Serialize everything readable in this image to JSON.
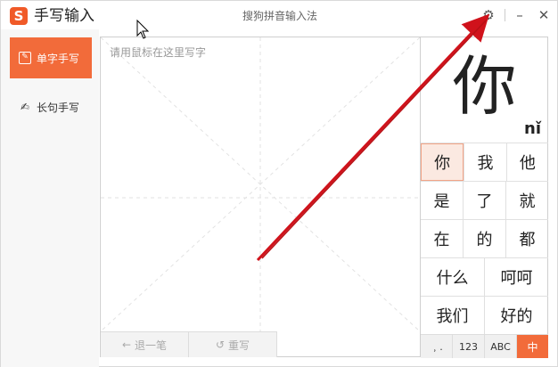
{
  "titlebar": {
    "app_title": "手写输入",
    "window_title": "搜狗拼音输入法",
    "logo_letter": "S",
    "settings_icon": "gear-icon",
    "minimize_icon": "minimize-icon",
    "close_icon": "close-icon"
  },
  "sidebar": {
    "items": [
      {
        "label": "单字手写",
        "icon": "pen-box-icon",
        "active": true
      },
      {
        "label": "长句手写",
        "icon": "pen-lines-icon",
        "active": false
      }
    ]
  },
  "pad": {
    "hint": "请用鼠标在这里写字",
    "undo_label": "退一笔",
    "rewrite_label": "重写"
  },
  "candidates": {
    "preview_char": "你",
    "preview_pinyin": "nǐ",
    "rows": [
      [
        "你",
        "我",
        "他"
      ],
      [
        "是",
        "了",
        "就"
      ],
      [
        "在",
        "的",
        "都"
      ],
      [
        "什么",
        "呵呵"
      ],
      [
        "我们",
        "好的"
      ]
    ],
    "selected": "你",
    "modes": [
      "﹐.",
      "123",
      "ABC",
      "中"
    ],
    "active_mode": "中"
  },
  "colors": {
    "accent": "#f26b3a",
    "arrow": "#d0121b"
  }
}
